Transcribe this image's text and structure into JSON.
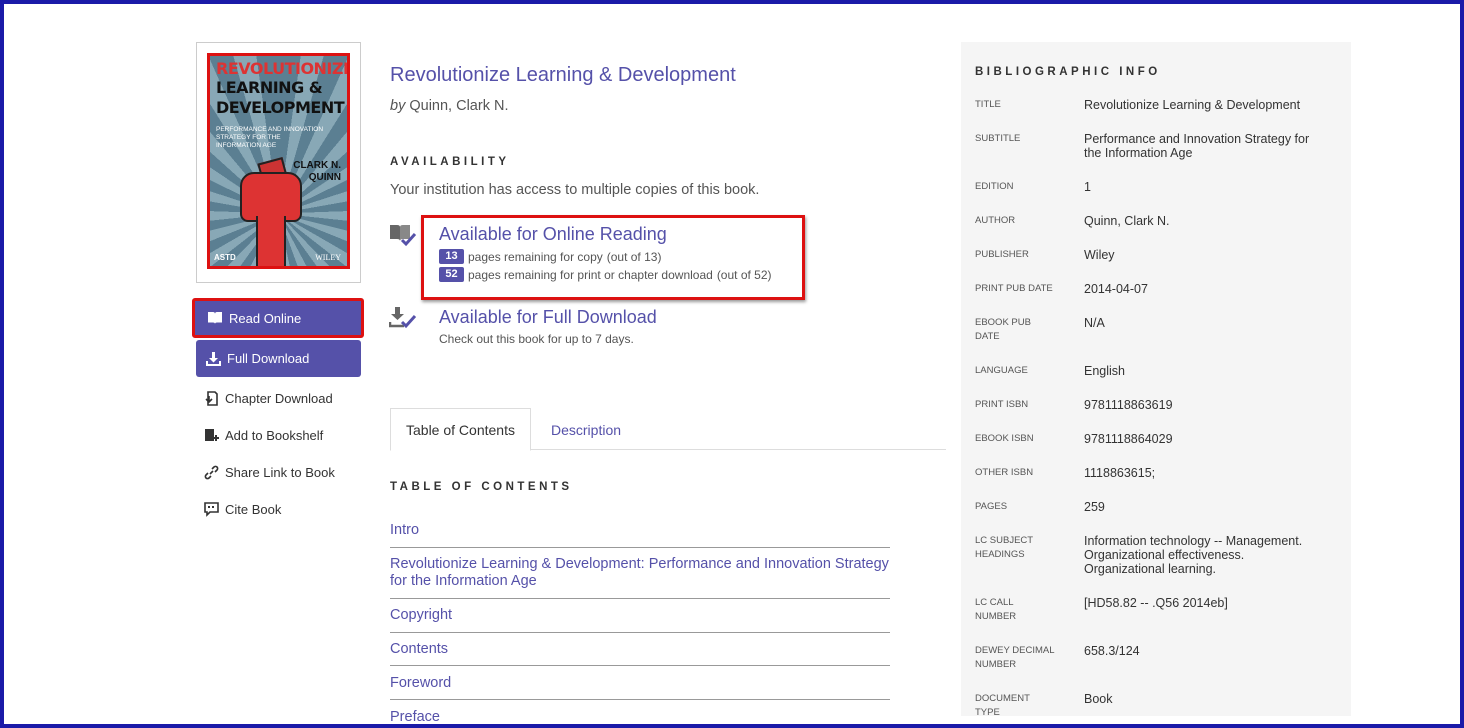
{
  "cover": {
    "title_line1": "REVOLUTIONIZE",
    "title_line2": "LEARNING &",
    "title_line3": "DEVELOPMENT",
    "subtitle": "PERFORMANCE AND INNOVATION STRATEGY FOR THE INFORMATION AGE",
    "author": "CLARK N. QUINN",
    "publisher_left": "ASTD",
    "publisher_right": "WILEY"
  },
  "actions": {
    "read_online": "Read Online",
    "full_download": "Full Download",
    "chapter_download": "Chapter Download",
    "add_to_bookshelf": "Add to Bookshelf",
    "share_link": "Share Link to Book",
    "cite_book": "Cite Book"
  },
  "book": {
    "title": "Revolutionize Learning & Development",
    "by": "by",
    "author": "Quinn, Clark N."
  },
  "availability": {
    "heading": "AVAILABILITY",
    "access_text": "Your institution has access to multiple copies of this book.",
    "online": {
      "title": "Available for Online Reading",
      "copy_count": "13",
      "copy_text": "pages remaining for copy",
      "copy_total": "(out of 13)",
      "print_count": "52",
      "print_text": "pages remaining for print or chapter download",
      "print_total": "(out of 52)"
    },
    "download": {
      "title": "Available for Full Download",
      "text": "Check out this book for up to 7 days."
    }
  },
  "tabs": {
    "toc": "Table of Contents",
    "description": "Description"
  },
  "toc": {
    "heading": "TABLE OF CONTENTS",
    "items": [
      "Intro",
      "Revolutionize Learning & Development: Performance and Innovation Strategy for the Information Age",
      "Copyright",
      "Contents",
      "Foreword",
      "Preface"
    ]
  },
  "biblio": {
    "heading": "BIBLIOGRAPHIC INFO",
    "rows": [
      {
        "label": "TITLE",
        "value": "Revolutionize Learning & Development"
      },
      {
        "label": "SUBTITLE",
        "value": "Performance and Innovation Strategy for the Information Age"
      },
      {
        "label": "EDITION",
        "value": "1"
      },
      {
        "label": "AUTHOR",
        "value": "Quinn, Clark N."
      },
      {
        "label": "PUBLISHER",
        "value": "Wiley"
      },
      {
        "label": "PRINT PUB DATE",
        "value": "2014-04-07"
      },
      {
        "label": "EBOOK PUB DATE",
        "value": "N/A"
      },
      {
        "label": "LANGUAGE",
        "value": "English"
      },
      {
        "label": "PRINT ISBN",
        "value": "9781118863619"
      },
      {
        "label": "EBOOK ISBN",
        "value": "9781118864029"
      },
      {
        "label": "OTHER ISBN",
        "value": "1118863615;"
      },
      {
        "label": "PAGES",
        "value": "259"
      },
      {
        "label": "LC SUBJECT HEADINGS",
        "value": "Information technology -- Management. Organizational effectiveness. Organizational learning."
      },
      {
        "label": "LC CALL NUMBER",
        "value": "[HD58.82 -- .Q56 2014eb]"
      },
      {
        "label": "DEWEY DECIMAL NUMBER",
        "value": "658.3/124"
      },
      {
        "label": "DOCUMENT TYPE",
        "value": "Book"
      }
    ]
  },
  "colors": {
    "accent": "#5551a9",
    "highlight_border": "#dd1111",
    "frame": "#1a1aa8"
  }
}
